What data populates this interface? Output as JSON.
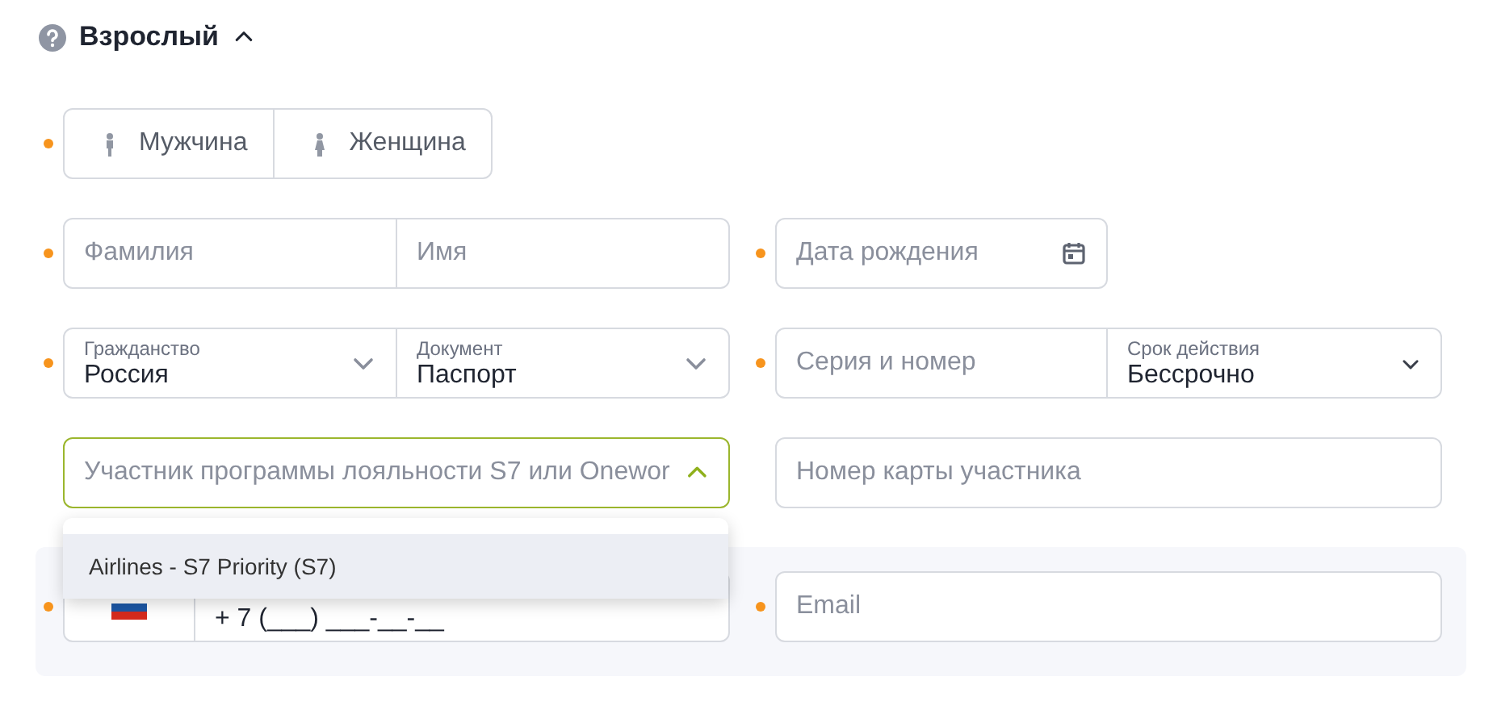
{
  "section": {
    "title": "Взрослый",
    "expanded": true
  },
  "gender": {
    "required": true,
    "options": [
      {
        "kind": "male",
        "label": "Мужчина",
        "selected": false
      },
      {
        "kind": "female",
        "label": "Женщина",
        "selected": false
      }
    ]
  },
  "name_row": {
    "required": true,
    "fields": [
      {
        "placeholder": "Фамилия"
      },
      {
        "placeholder": "Имя"
      }
    ]
  },
  "birth_date": {
    "required": true,
    "placeholder": "Дата рождения"
  },
  "document_row": {
    "required": true,
    "selects": [
      {
        "label": "Гражданство",
        "value": "Россия"
      },
      {
        "label": "Документ",
        "value": "Паспорт"
      }
    ]
  },
  "document_number": {
    "required": true,
    "placeholder": "Серия и номер",
    "validity": {
      "label": "Срок действия",
      "value": "Бессрочно"
    }
  },
  "loyalty": {
    "required": false,
    "placeholder": "Участник программы лояльности S7 или Onewor",
    "expanded": true,
    "options": [
      {
        "label": "Airlines - S7 Priority (S7)",
        "selected": true
      }
    ]
  },
  "card_number": {
    "required": false,
    "placeholder": "Номер карты участника"
  },
  "phone": {
    "required": true,
    "value": "+ 7 (___) ___-__-__"
  },
  "email": {
    "required": true,
    "placeholder": "Email"
  }
}
